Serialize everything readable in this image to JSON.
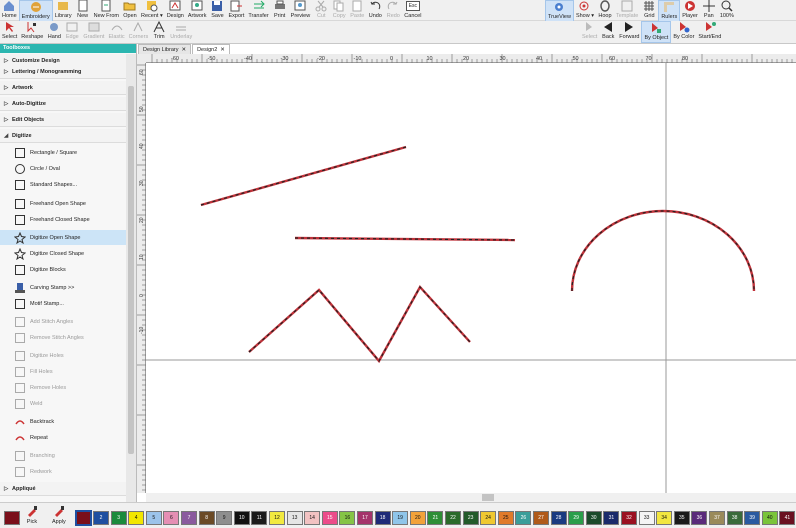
{
  "toolbar_top": {
    "left": [
      {
        "label": "Home",
        "icon": "home-icon"
      },
      {
        "label": "Embroidery",
        "icon": "embroidery-icon",
        "active": true
      },
      {
        "label": "Library",
        "icon": "library-icon"
      },
      {
        "label": "New",
        "icon": "new-file-icon"
      },
      {
        "label": "New From",
        "icon": "new-from-icon"
      },
      {
        "label": "Open",
        "icon": "open-folder-icon"
      },
      {
        "label": "Recent",
        "icon": "recent-icon",
        "dropdown": true
      },
      {
        "label": "Design",
        "icon": "design-icon"
      },
      {
        "label": "Artwork",
        "icon": "artwork-icon"
      },
      {
        "label": "Save",
        "icon": "save-icon"
      },
      {
        "label": "Export",
        "icon": "export-icon"
      },
      {
        "label": "Transfer",
        "icon": "transfer-icon"
      },
      {
        "label": "Print",
        "icon": "print-icon"
      },
      {
        "label": "Preview",
        "icon": "preview-icon"
      },
      {
        "label": "Cut",
        "icon": "cut-icon",
        "disabled": true
      },
      {
        "label": "Copy",
        "icon": "copy-icon",
        "disabled": true
      },
      {
        "label": "Paste",
        "icon": "paste-icon",
        "disabled": true
      },
      {
        "label": "Undo",
        "icon": "undo-icon"
      },
      {
        "label": "Redo",
        "icon": "redo-icon",
        "disabled": true
      },
      {
        "label": "Cancel",
        "icon": "cancel-icon",
        "key": "Esc"
      }
    ],
    "right": [
      {
        "label": "TrueView",
        "icon": "trueview-icon",
        "active": true
      },
      {
        "label": "Show",
        "icon": "show-icon",
        "dropdown": true
      },
      {
        "label": "Hoop",
        "icon": "hoop-icon"
      },
      {
        "label": "Template",
        "icon": "template-icon",
        "disabled": true
      },
      {
        "label": "Grid",
        "icon": "grid-icon"
      },
      {
        "label": "Rulers",
        "icon": "rulers-icon",
        "active": true
      },
      {
        "label": "Player",
        "icon": "player-icon"
      },
      {
        "label": "Pan",
        "icon": "pan-icon"
      },
      {
        "label": "100%",
        "icon": "zoom-100-icon"
      }
    ]
  },
  "toolbar_second": {
    "left": [
      {
        "label": "Select",
        "icon": "select-arrow-icon"
      },
      {
        "label": "Reshape",
        "icon": "reshape-icon"
      },
      {
        "label": "Hand",
        "icon": "hand-icon"
      },
      {
        "label": "Edge",
        "icon": "edge-icon",
        "disabled": true
      },
      {
        "label": "Gradient",
        "icon": "gradient-icon",
        "disabled": true
      },
      {
        "label": "Elastic",
        "icon": "elastic-icon",
        "disabled": true
      },
      {
        "label": "Corners",
        "icon": "corners-icon",
        "disabled": true
      },
      {
        "label": "Trim",
        "icon": "trim-icon"
      },
      {
        "label": "Underlay",
        "icon": "underlay-icon",
        "disabled": true
      }
    ],
    "right": [
      {
        "label": "Select",
        "icon": "select-seq-icon",
        "disabled": true
      },
      {
        "label": "Back",
        "icon": "back-icon"
      },
      {
        "label": "Forward",
        "icon": "forward-icon"
      },
      {
        "label": "By Object",
        "icon": "by-object-icon",
        "active": true
      },
      {
        "label": "By Color",
        "icon": "by-color-icon"
      },
      {
        "label": "Start/End",
        "icon": "start-end-icon"
      }
    ]
  },
  "doc_tabs": [
    "Design Library",
    "Design2"
  ],
  "toolboxes": {
    "title": "Toolboxes",
    "rows": [
      {
        "kind": "cat",
        "label": "Customize Design",
        "collapsed": true
      },
      {
        "kind": "cat",
        "label": "Lettering / Monogramming",
        "collapsed": true
      },
      {
        "kind": "cat",
        "label": "Artwork",
        "collapsed": true
      },
      {
        "kind": "cat",
        "label": "Auto-Digitize",
        "collapsed": true
      },
      {
        "kind": "cat",
        "label": "Edit Objects",
        "collapsed": true
      },
      {
        "kind": "cat",
        "label": "Digitize",
        "collapsed": false
      },
      {
        "kind": "item",
        "label": "Rectangle / Square",
        "icon": "rectangle-icon"
      },
      {
        "kind": "item",
        "label": "Circle / Oval",
        "icon": "circle-icon"
      },
      {
        "kind": "item",
        "label": "Standard Shapes...",
        "icon": "standard-shapes-icon"
      },
      {
        "kind": "item",
        "label": "Freehand Open Shape",
        "icon": "freehand-open-icon"
      },
      {
        "kind": "item",
        "label": "Freehand Closed Shape",
        "icon": "freehand-closed-icon"
      },
      {
        "kind": "item",
        "label": "Digitize Open Shape",
        "icon": "digitize-open-icon",
        "selected": true
      },
      {
        "kind": "item",
        "label": "Digitize Closed Shape",
        "icon": "digitize-closed-icon"
      },
      {
        "kind": "item",
        "label": "Digitize Blocks",
        "icon": "digitize-blocks-icon"
      },
      {
        "kind": "item",
        "label": "Carving Stamp >>",
        "icon": "carving-stamp-icon"
      },
      {
        "kind": "item",
        "label": "Motif Stamp...",
        "icon": "motif-stamp-icon"
      },
      {
        "kind": "item",
        "label": "Add Stitch Angles",
        "icon": "add-angles-icon",
        "disabled": true
      },
      {
        "kind": "item",
        "label": "Remove Stitch Angles",
        "icon": "remove-angles-icon",
        "disabled": true
      },
      {
        "kind": "item",
        "label": "Digitize Holes",
        "icon": "digitize-holes-icon",
        "disabled": true
      },
      {
        "kind": "item",
        "label": "Fill Holes",
        "icon": "fill-holes-icon",
        "disabled": true
      },
      {
        "kind": "item",
        "label": "Remove Holes",
        "icon": "remove-holes-icon",
        "disabled": true
      },
      {
        "kind": "item",
        "label": "Weld",
        "icon": "weld-icon",
        "disabled": true
      },
      {
        "kind": "item",
        "label": "Backtrack",
        "icon": "backtrack-icon"
      },
      {
        "kind": "item",
        "label": "Repeat",
        "icon": "repeat-icon"
      },
      {
        "kind": "item",
        "label": "Branching",
        "icon": "branching-icon",
        "disabled": true
      },
      {
        "kind": "item",
        "label": "Redwork",
        "icon": "redwork-icon",
        "disabled": true
      },
      {
        "kind": "cat",
        "label": "Appliqué",
        "collapsed": true
      }
    ]
  },
  "rulers": {
    "h_labels": [
      "-60",
      "-50",
      "-40",
      "-30",
      "-20",
      "-10",
      "0",
      "10",
      "20",
      "30",
      "40",
      "50",
      "60",
      "70",
      "80"
    ],
    "v_labels": [
      "60",
      "50",
      "40",
      "30",
      "20",
      "10",
      "0",
      "-10"
    ]
  },
  "colors": {
    "accent": "#2cb6b0",
    "stitch_red": "#c0323a",
    "stitch_dark": "#222222",
    "selection": "#cce4f7"
  },
  "palette": {
    "tools": [
      {
        "label": "Pick",
        "icon": "eyedropper-icon"
      },
      {
        "label": "Apply",
        "icon": "apply-color-icon"
      }
    ],
    "swatches": [
      {
        "n": "1",
        "c": "#7a0f1a"
      },
      {
        "n": "2",
        "c": "#1f4fa0"
      },
      {
        "n": "3",
        "c": "#1a8a3c"
      },
      {
        "n": "4",
        "c": "#f2e600"
      },
      {
        "n": "5",
        "c": "#9cc3ea"
      },
      {
        "n": "6",
        "c": "#e58fb4"
      },
      {
        "n": "7",
        "c": "#8a5a9e"
      },
      {
        "n": "8",
        "c": "#6b4a26"
      },
      {
        "n": "9",
        "c": "#8e8e8e"
      },
      {
        "n": "10",
        "c": "#111111"
      },
      {
        "n": "11",
        "c": "#1b1b1b"
      },
      {
        "n": "12",
        "c": "#f2ea40"
      },
      {
        "n": "13",
        "c": "#e5e5e5"
      },
      {
        "n": "14",
        "c": "#f2c2c2"
      },
      {
        "n": "15",
        "c": "#ec4c8a"
      },
      {
        "n": "16",
        "c": "#85c446"
      },
      {
        "n": "17",
        "c": "#a4346b"
      },
      {
        "n": "18",
        "c": "#1e2a78"
      },
      {
        "n": "19",
        "c": "#8fc5e9"
      },
      {
        "n": "20",
        "c": "#f2a23a"
      },
      {
        "n": "21",
        "c": "#2e8e36"
      },
      {
        "n": "22",
        "c": "#2a6a2a"
      },
      {
        "n": "23",
        "c": "#235a2a"
      },
      {
        "n": "24",
        "c": "#f0c830"
      },
      {
        "n": "25",
        "c": "#e07a2a"
      },
      {
        "n": "26",
        "c": "#3a9e9a"
      },
      {
        "n": "27",
        "c": "#b05a1a"
      },
      {
        "n": "28",
        "c": "#1a3a80"
      },
      {
        "n": "29",
        "c": "#2a9e4a"
      },
      {
        "n": "30",
        "c": "#1a4a2a"
      },
      {
        "n": "31",
        "c": "#1a2a6a"
      },
      {
        "n": "32",
        "c": "#9a1020"
      },
      {
        "n": "33",
        "c": "#f4f4f4"
      },
      {
        "n": "34",
        "c": "#f2e640"
      },
      {
        "n": "35",
        "c": "#1a1a1a"
      },
      {
        "n": "36",
        "c": "#5a2a7a"
      },
      {
        "n": "37",
        "c": "#9a8a5a"
      },
      {
        "n": "38",
        "c": "#3a6a3a"
      },
      {
        "n": "39",
        "c": "#2a5aa0"
      },
      {
        "n": "40",
        "c": "#7ac43a"
      },
      {
        "n": "41",
        "c": "#6a1020"
      }
    ]
  }
}
